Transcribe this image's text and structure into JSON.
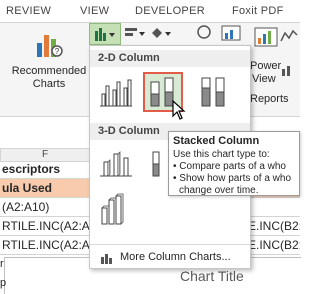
{
  "ribbon_tabs": [
    "REVIEW",
    "VIEW",
    "DEVELOPER",
    "Foxit PDF"
  ],
  "ribbon": {
    "recommended_charts_line1": "Recommended",
    "recommended_charts_line2": "Charts",
    "power_view_line1": "Power",
    "power_view_line2": "View",
    "reports_label": "Reports"
  },
  "menu": {
    "section_2d": "2-D Column",
    "section_3d": "3-D Column",
    "footer_label": "More Column Charts...",
    "selected_option": "Stacked Column"
  },
  "tooltip": {
    "title": "Stacked Column",
    "line1": "Use this chart type to:",
    "line2": "• Compare parts of a who",
    "line3": "• Show how parts of a who",
    "line4": "change over time."
  },
  "sheet": {
    "column_header": "F",
    "row_descriptors": "escriptors",
    "row_formula": "ula Used",
    "row_a": "(A2:A10)",
    "row_b_left": "RTILE.INC(A2:A1",
    "row_b_right": "E.INC(B2:",
    "row_c_left": "RTILE.INC(A2:A1",
    "row_c_right": "E.INC(B2:",
    "chart_title": "Chart Title",
    "edge_char_1": "r",
    "edge_char_2": "p"
  },
  "colors": {
    "accent_selected_border": "#e15d4a",
    "selected_bg": "#d8ead3",
    "header_orange": "#f8cbad",
    "excel_green": "#217346"
  }
}
